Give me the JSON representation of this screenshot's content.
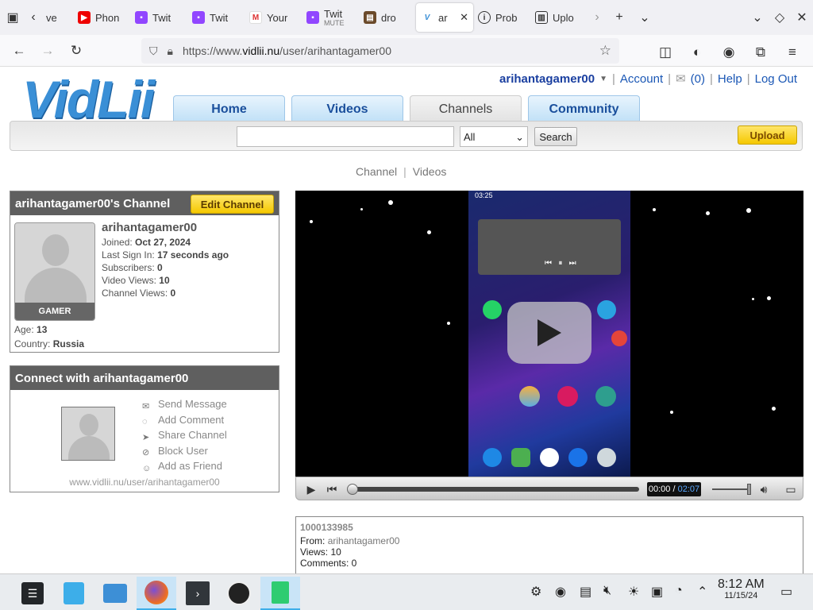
{
  "browser": {
    "tabs": [
      {
        "label": "ve",
        "icon": "back-chevron-icon"
      },
      {
        "label": "Phon",
        "icon": "youtube-icon"
      },
      {
        "label": "Twit",
        "icon": "twitch-icon"
      },
      {
        "label": "Twit",
        "icon": "twitch-icon"
      },
      {
        "label": "Your",
        "icon": "gmail-icon"
      },
      {
        "label": "Twit",
        "sub": "MUTE",
        "icon": "twitch-icon"
      },
      {
        "label": "dro",
        "icon": "image-icon"
      },
      {
        "label": "ar",
        "icon": "vidlii-icon",
        "active": true
      },
      {
        "label": "Prob",
        "icon": "info-icon"
      },
      {
        "label": "Uplo",
        "icon": "upload-icon"
      }
    ],
    "url_prefix": "https://www.",
    "url_host": "vidlii.nu",
    "url_path": "/user/arihantagamer00"
  },
  "site": {
    "logo": "VidLii",
    "user_menu": "arihantagamer00",
    "account": "Account",
    "messages": "(0)",
    "help": "Help",
    "logout": "Log Out",
    "tabs": [
      "Home",
      "Videos",
      "Channels",
      "Community"
    ],
    "search_placeholder": "",
    "search_select": "All",
    "search_button": "Search",
    "upload": "Upload",
    "subnav_channel": "Channel",
    "subnav_videos": "Videos"
  },
  "channel_box": {
    "title": "arihantagamer00's Channel",
    "edit": "Edit Channel",
    "badge": "GAMER",
    "name": "arihantagamer00",
    "joined_label": "Joined:",
    "joined": "Oct 27, 2024",
    "last_label": "Last Sign In:",
    "last": "17 seconds ago",
    "subs_label": "Subscribers:",
    "subs": "0",
    "vviews_label": "Video Views:",
    "vviews": "10",
    "cviews_label": "Channel Views:",
    "cviews": "0",
    "age_label": "Age:",
    "age": "13",
    "country_label": "Country:",
    "country": "Russia"
  },
  "connect_box": {
    "title": "Connect with arihantagamer00",
    "actions": [
      "Send Message",
      "Add Comment",
      "Share Channel",
      "Block User",
      "Add as Friend"
    ],
    "link": "www.vidlii.nu/user/arihantagamer00"
  },
  "player": {
    "time_current": "00:00",
    "time_total": "02:07",
    "phone_status": "03:25"
  },
  "video_info": {
    "title": "1000133985",
    "from_label": "From:",
    "from": "arihantagamer00",
    "views": "Views: 10",
    "comments": "Comments: 0"
  },
  "taskbar": {
    "time": "8:12 AM",
    "date": "11/15/24"
  }
}
